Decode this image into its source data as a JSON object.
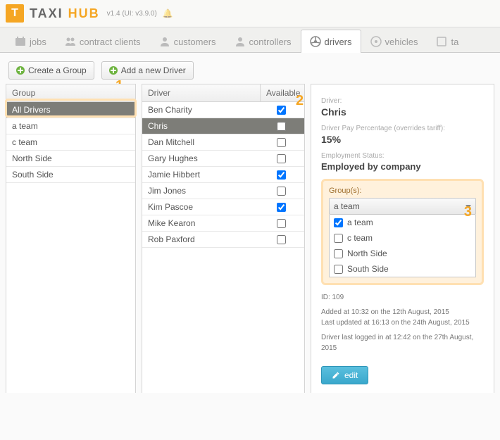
{
  "header": {
    "logo_letter": "T",
    "brand_a": "TAXI ",
    "brand_b": "HUB",
    "version": "v1.4 (UI: v3.9.0)"
  },
  "tabs": [
    {
      "label": "jobs"
    },
    {
      "label": "contract clients"
    },
    {
      "label": "customers"
    },
    {
      "label": "controllers"
    },
    {
      "label": "drivers",
      "active": true
    },
    {
      "label": "vehicles"
    },
    {
      "label": "ta"
    }
  ],
  "toolbar": {
    "create_group": "Create a Group",
    "add_driver": "Add a new Driver"
  },
  "annotations": {
    "one": "1",
    "two": "2",
    "three": "3"
  },
  "groups": {
    "header": "Group",
    "items": [
      {
        "name": "All Drivers",
        "selected": true
      },
      {
        "name": "a team"
      },
      {
        "name": "c team"
      },
      {
        "name": "North Side"
      },
      {
        "name": "South Side"
      }
    ]
  },
  "drivers": {
    "header_name": "Driver",
    "header_avail": "Available",
    "items": [
      {
        "name": "Ben Charity",
        "available": true
      },
      {
        "name": "Chris",
        "available": false,
        "selected": true
      },
      {
        "name": "Dan Mitchell",
        "available": false
      },
      {
        "name": "Gary Hughes",
        "available": false
      },
      {
        "name": "Jamie Hibbert",
        "available": true
      },
      {
        "name": "Jim Jones",
        "available": false
      },
      {
        "name": "Kim Pascoe",
        "available": true
      },
      {
        "name": "Mike Kearon",
        "available": false
      },
      {
        "name": "Rob Paxford",
        "available": false
      }
    ]
  },
  "detail": {
    "driver_label": "Driver:",
    "driver_name": "Chris",
    "pay_label": "Driver Pay Percentage (overrides tariff):",
    "pay_value": "15%",
    "emp_label": "Employment Status:",
    "emp_value": "Employed by company",
    "groups_label": "Group(s):",
    "groups_selected": "a team",
    "group_options": [
      {
        "label": "a team",
        "checked": true
      },
      {
        "label": "c team",
        "checked": false
      },
      {
        "label": "North Side",
        "checked": false
      },
      {
        "label": "South Side",
        "checked": false
      }
    ],
    "id_line": "ID: 109",
    "added_line": "Added at 10:32 on the 12th August, 2015",
    "updated_line": "Last updated at 16:13 on the 24th August, 2015",
    "login_line": "Driver last logged in at 12:42 on the 27th August, 2015",
    "edit_label": "edit"
  }
}
